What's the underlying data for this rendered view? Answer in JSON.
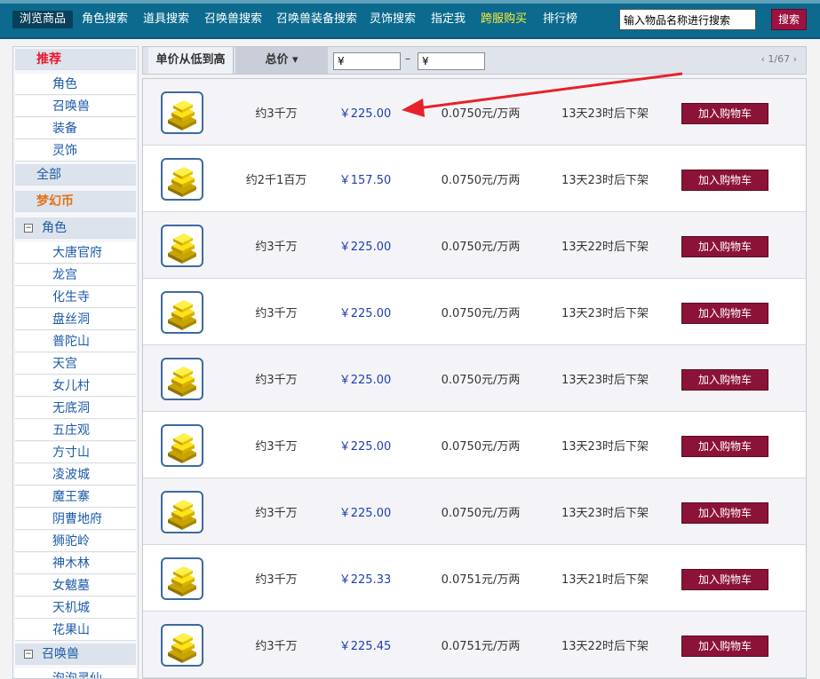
{
  "nav": {
    "items": [
      "浏览商品",
      "角色搜索",
      "道具搜索",
      "召唤兽搜索",
      "召唤兽装备搜索",
      "灵饰搜索",
      "指定我",
      "跨服购买",
      "排行榜"
    ],
    "search_placeholder": "输入物品名称进行搜索",
    "search_button": "搜索"
  },
  "sidebar": {
    "recommend": "推荐",
    "recommend_items": [
      "角色",
      "召唤兽",
      "装备",
      "灵饰"
    ],
    "all": "全部",
    "coin": "梦幻币",
    "role_section": "角色",
    "schools": [
      "大唐官府",
      "龙宫",
      "化生寺",
      "盘丝洞",
      "普陀山",
      "天宫",
      "女儿村",
      "无底洞",
      "五庄观",
      "方寸山",
      "凌波城",
      "魔王寨",
      "阴曹地府",
      "狮驼岭",
      "神木林",
      "女魃墓",
      "天机城",
      "花果山"
    ],
    "pet_section": "召唤兽",
    "partial_item": "泡泡灵仙",
    "toggle_minus": "−"
  },
  "filter": {
    "sort_unit": "单价从低到高",
    "sort_total": "总价",
    "sort_total_arrow": "▾",
    "price_min": "¥",
    "price_max": "¥",
    "dash": "–",
    "pager": "‹  1/67  ›"
  },
  "listings": [
    {
      "amount": "约3千万",
      "price": "￥225.00",
      "rate": "0.0750元/万两",
      "time": "13天23时后下架",
      "button": "加入购物车"
    },
    {
      "amount": "约2千1百万",
      "price": "￥157.50",
      "rate": "0.0750元/万两",
      "time": "13天23时后下架",
      "button": "加入购物车"
    },
    {
      "amount": "约3千万",
      "price": "￥225.00",
      "rate": "0.0750元/万两",
      "time": "13天22时后下架",
      "button": "加入购物车"
    },
    {
      "amount": "约3千万",
      "price": "￥225.00",
      "rate": "0.0750元/万两",
      "time": "13天23时后下架",
      "button": "加入购物车"
    },
    {
      "amount": "约3千万",
      "price": "￥225.00",
      "rate": "0.0750元/万两",
      "time": "13天23时后下架",
      "button": "加入购物车"
    },
    {
      "amount": "约3千万",
      "price": "￥225.00",
      "rate": "0.0750元/万两",
      "time": "13天23时后下架",
      "button": "加入购物车"
    },
    {
      "amount": "约3千万",
      "price": "￥225.00",
      "rate": "0.0750元/万两",
      "time": "13天23时后下架",
      "button": "加入购物车"
    },
    {
      "amount": "约3千万",
      "price": "￥225.33",
      "rate": "0.0751元/万两",
      "time": "13天21时后下架",
      "button": "加入购物车"
    },
    {
      "amount": "约3千万",
      "price": "￥225.45",
      "rate": "0.0751元/万两",
      "time": "13天22时后下架",
      "button": "加入购物车"
    }
  ],
  "colors": {
    "nav_bg": "#0b6a8e",
    "accent_button": "#8c1338",
    "price_text": "#1e3fb0",
    "recommend_red": "#e8162c",
    "coin_orange": "#e1731a",
    "annotation_arrow": "#e8202a"
  },
  "icons": {
    "item_thumbnail": "gold-bars-icon",
    "annotation": "red-arrow"
  }
}
